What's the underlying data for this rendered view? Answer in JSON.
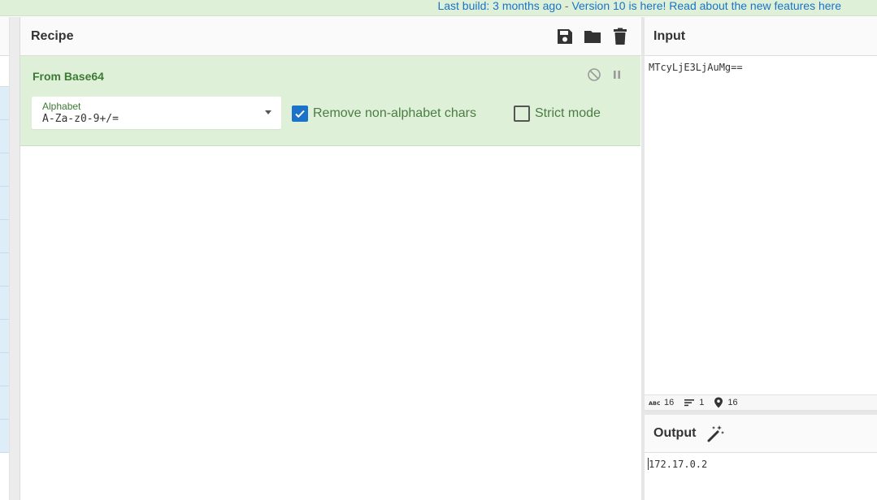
{
  "banner": {
    "last_build": "Last build: 3 months ago",
    "separator": " - ",
    "version_text": "Version 10 is here! Read about the new features ",
    "here_link": "here"
  },
  "recipe": {
    "title": "Recipe",
    "toolbar_icons": [
      "save-icon",
      "folder-icon",
      "trash-icon"
    ],
    "operation": {
      "name": "From Base64",
      "alphabet_label": "Alphabet",
      "alphabet_value": "A-Za-z0-9+/=",
      "remove_non_alphabet_label": "Remove non-alphabet chars",
      "remove_non_alphabet_checked": true,
      "strict_mode_label": "Strict mode",
      "strict_mode_checked": false
    }
  },
  "input": {
    "title": "Input",
    "value": "MTcyLjE3LjAuMg==",
    "stats": {
      "length": "16",
      "lines": "1",
      "position": "16"
    }
  },
  "output": {
    "title": "Output",
    "value": "172.17.0.2"
  },
  "colors": {
    "op_background": "#dff0d8",
    "op_text": "#3c7a34",
    "link": "#1a73c8",
    "checkbox_on": "#1a73c8"
  }
}
